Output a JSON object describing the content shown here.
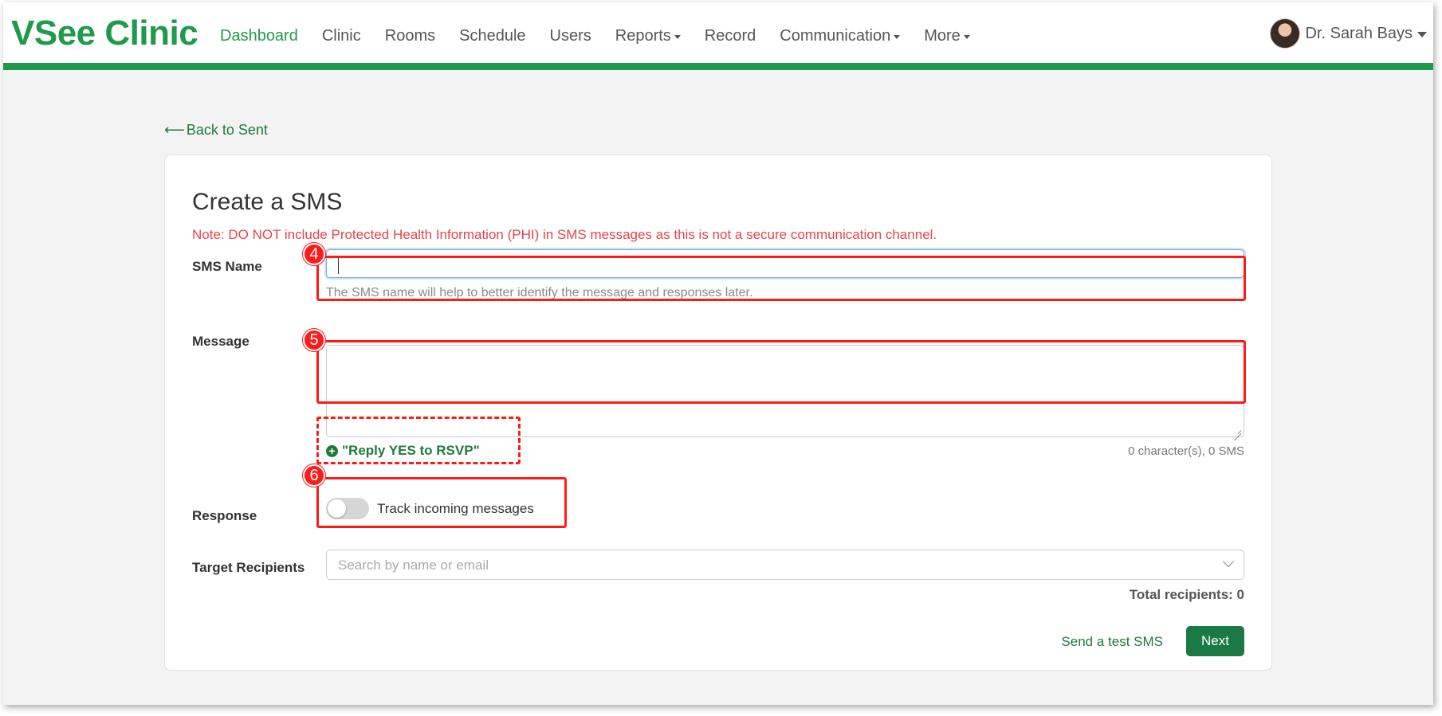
{
  "app": {
    "logo": "VSee Clinic"
  },
  "nav": {
    "items": [
      {
        "label": "Dashboard",
        "active": true,
        "dropdown": false
      },
      {
        "label": "Clinic",
        "active": false,
        "dropdown": false
      },
      {
        "label": "Rooms",
        "active": false,
        "dropdown": false
      },
      {
        "label": "Schedule",
        "active": false,
        "dropdown": false
      },
      {
        "label": "Users",
        "active": false,
        "dropdown": false
      },
      {
        "label": "Reports",
        "active": false,
        "dropdown": true
      },
      {
        "label": "Record",
        "active": false,
        "dropdown": false
      },
      {
        "label": "Communication",
        "active": false,
        "dropdown": true
      },
      {
        "label": "More",
        "active": false,
        "dropdown": true
      }
    ],
    "user_name": "Dr. Sarah Bays"
  },
  "back_link": "Back to Sent",
  "form": {
    "title": "Create a SMS",
    "note": "Note: DO NOT include Protected Health Information (PHI) in SMS messages as this is not a secure communication channel.",
    "sms_name_label": "SMS Name",
    "sms_name_value": "",
    "sms_name_help": "The SMS name will help to better identify the message and responses later.",
    "message_label": "Message",
    "message_value": "",
    "rsvp_label": "\"Reply YES to RSVP\"",
    "char_count": "0 character(s), 0 SMS",
    "response_label": "Response",
    "track_label": "Track incoming messages",
    "track_enabled": false,
    "recipients_label": "Target Recipients",
    "recipients_placeholder": "Search by name or email",
    "total_recipients": "Total recipients: 0",
    "test_link": "Send a test SMS",
    "next_button": "Next"
  },
  "annotations": {
    "marker_4": "4",
    "marker_5": "5",
    "marker_6": "6",
    "color": "#ff1a1a"
  },
  "colors": {
    "brand": "#1f9a4a",
    "button": "#1b7a44",
    "note": "#e8434f"
  }
}
